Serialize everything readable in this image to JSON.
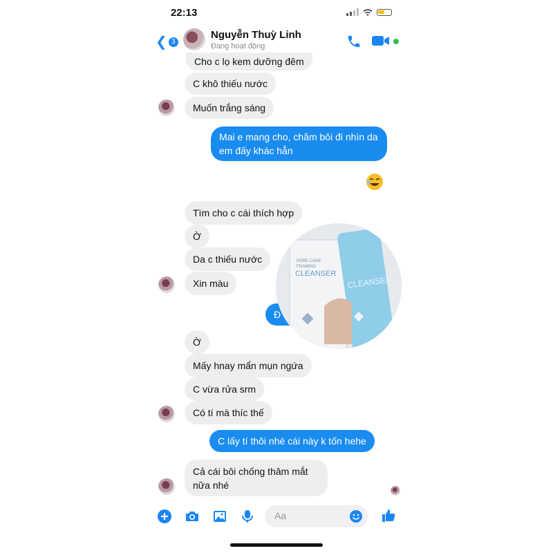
{
  "status_bar": {
    "time": "22:13"
  },
  "header": {
    "back_badge": "3",
    "contact_name": "Nguyễn Thuỳ Linh",
    "presence": "Đang hoạt động"
  },
  "messages": [
    {
      "side": "in",
      "text": "Cho c lọ kem dưỡng đêm"
    },
    {
      "side": "in",
      "text": "C khô thiếu nước"
    },
    {
      "side": "in",
      "text": "Muốn trắng sáng"
    },
    {
      "side": "out",
      "text": "Mai e mang cho, chăm bôi đi nhìn da em đấy khác hẳn"
    },
    {
      "side": "in",
      "text": "Tìm cho c cái thích hợp"
    },
    {
      "side": "in",
      "text": "Ờ"
    },
    {
      "side": "in",
      "text": "Da c thiếu nước"
    },
    {
      "side": "in",
      "text": "Xin màu"
    },
    {
      "side": "out",
      "text": "Đ"
    },
    {
      "side": "in",
      "text": "Ờ"
    },
    {
      "side": "in",
      "text": "Mấy hnay mẩn mụn ngứa"
    },
    {
      "side": "in",
      "text": "C vừa rửa srm"
    },
    {
      "side": "in",
      "text": "Có tí mà thíc thế"
    },
    {
      "side": "out",
      "text": "C lấy tí thôi nhé cái này k tốn hehe"
    },
    {
      "side": "in",
      "text": "Cả cái bôi chống thâm mắt nữa nhé"
    }
  ],
  "photo": {
    "box_text_line1": "PORE CARE",
    "box_text_line2": "FOAMING",
    "box_title": "CLEANSER",
    "tube_title": "CLEANSER"
  },
  "composer": {
    "placeholder": "Aa"
  },
  "colors": {
    "accent": "#1a8cf0",
    "incoming_bubble": "#eeeeef"
  }
}
